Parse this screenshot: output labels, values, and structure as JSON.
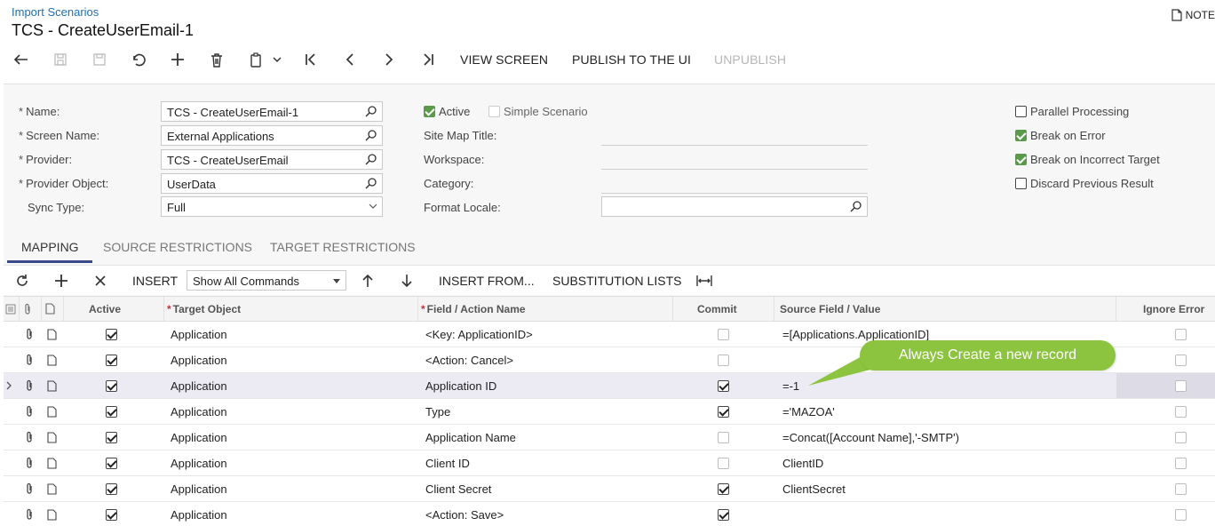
{
  "header": {
    "breadcrumb": "Import Scenarios",
    "title": "TCS - CreateUserEmail-1",
    "notes": "NOTE"
  },
  "toolbar": {
    "view_screen": "VIEW SCREEN",
    "publish": "PUBLISH TO THE UI",
    "unpublish": "UNPUBLISH"
  },
  "form": {
    "name_label": "Name:",
    "name_value": "TCS - CreateUserEmail-1",
    "screen_name_label": "Screen Name:",
    "screen_name_value": "External Applications",
    "provider_label": "Provider:",
    "provider_value": "TCS - CreateUserEmail",
    "provider_object_label": "Provider Object:",
    "provider_object_value": "UserData",
    "sync_type_label": "Sync Type:",
    "sync_type_value": "Full",
    "active_label": "Active",
    "simple_scenario_label": "Simple Scenario",
    "site_map_title_label": "Site Map Title:",
    "workspace_label": "Workspace:",
    "category_label": "Category:",
    "format_locale_label": "Format Locale:",
    "parallel_processing_label": "Parallel Processing",
    "break_on_error_label": "Break on Error",
    "break_on_incorrect_target_label": "Break on Incorrect Target",
    "discard_previous_result_label": "Discard Previous Result",
    "active_checked": true,
    "simple_scenario_checked": false,
    "parallel_processing_checked": false,
    "break_on_error_checked": true,
    "break_on_incorrect_target_checked": true,
    "discard_previous_result_checked": false
  },
  "tabs": {
    "mapping": "MAPPING",
    "source_restrictions": "SOURCE RESTRICTIONS",
    "target_restrictions": "TARGET RESTRICTIONS"
  },
  "grid_toolbar": {
    "insert": "INSERT",
    "show_commands": "Show All Commands",
    "insert_from": "INSERT FROM...",
    "substitution_lists": "SUBSTITUTION LISTS"
  },
  "grid": {
    "headers": {
      "active": "Active",
      "target_object": "Target Object",
      "field_action": "Field / Action Name",
      "commit": "Commit",
      "source_field": "Source Field / Value",
      "ignore_error": "Ignore Error"
    },
    "rows": [
      {
        "active": true,
        "target": "Application",
        "field": "<Key: ApplicationID>",
        "commit": false,
        "source": "=[Applications.ApplicationID]",
        "ignore": false
      },
      {
        "active": true,
        "target": "Application",
        "field": "<Action: Cancel>",
        "commit": false,
        "source": "",
        "ignore": false
      },
      {
        "active": true,
        "target": "Application",
        "field": "Application ID",
        "commit": true,
        "source": "=-1",
        "ignore": false
      },
      {
        "active": true,
        "target": "Application",
        "field": "Type",
        "commit": true,
        "source": "='MAZOA'",
        "ignore": false
      },
      {
        "active": true,
        "target": "Application",
        "field": "Application Name",
        "commit": false,
        "source": "=Concat([Account Name],'-SMTP')",
        "ignore": false
      },
      {
        "active": true,
        "target": "Application",
        "field": "Client ID",
        "commit": false,
        "source": "ClientID",
        "ignore": false
      },
      {
        "active": true,
        "target": "Application",
        "field": "Client Secret",
        "commit": true,
        "source": "ClientSecret",
        "ignore": false
      },
      {
        "active": true,
        "target": "Application",
        "field": "<Action: Save>",
        "commit": true,
        "source": "",
        "ignore": false
      }
    ]
  },
  "callout": {
    "text": "Always Create a new record",
    "color": "#8cc440"
  }
}
